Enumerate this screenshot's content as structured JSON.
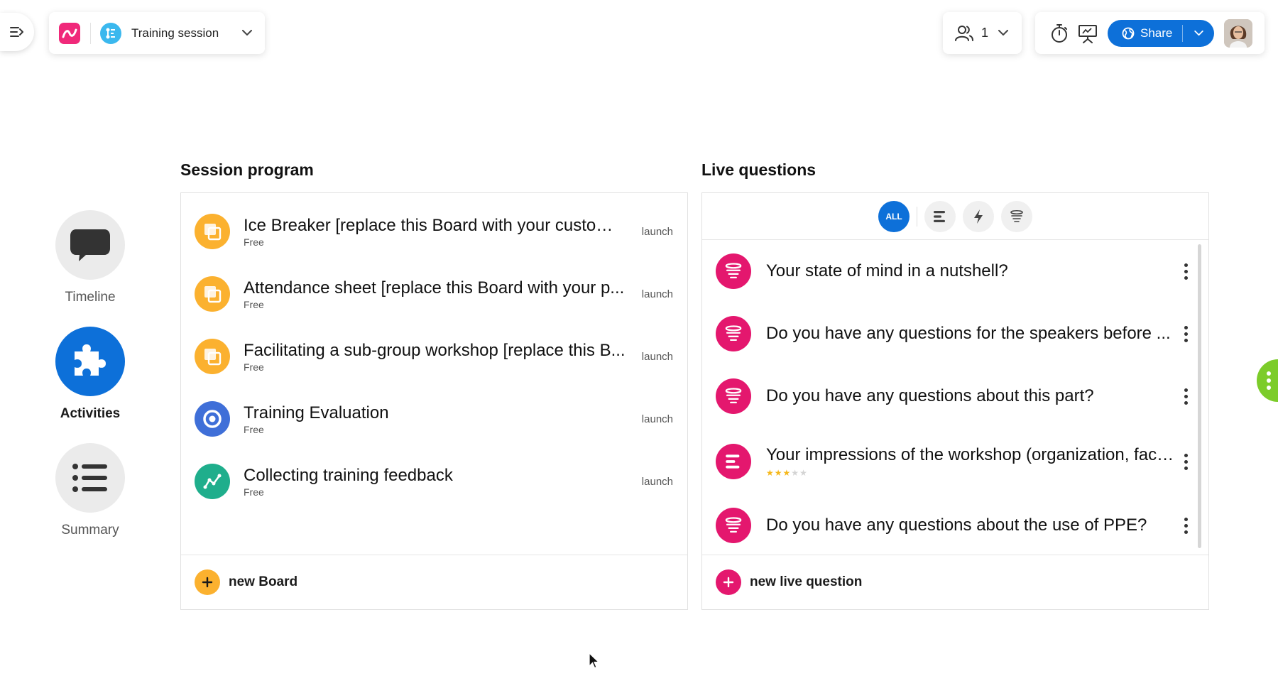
{
  "header": {
    "session_name": "Training session",
    "participants_count": "1",
    "share_label": "Share"
  },
  "nav": {
    "items": [
      {
        "label": "Timeline",
        "icon": "speech-bubble-icon",
        "active": false
      },
      {
        "label": "Activities",
        "icon": "puzzle-icon",
        "active": true
      },
      {
        "label": "Summary",
        "icon": "list-icon",
        "active": false
      }
    ]
  },
  "program": {
    "title": "Session program",
    "rows": [
      {
        "title": "Ice Breaker [replace this Board with your custom ...",
        "subtitle": "Free",
        "action": "launch",
        "icon": "board-icon",
        "color": "#fbb12f"
      },
      {
        "title": "Attendance sheet [replace this Board with your p...",
        "subtitle": "Free",
        "action": "launch",
        "icon": "board-icon",
        "color": "#fbb12f"
      },
      {
        "title": "Facilitating a sub-group workshop [replace this B...",
        "subtitle": "Free",
        "action": "launch",
        "icon": "board-icon",
        "color": "#fbb12f"
      },
      {
        "title": "Training Evaluation",
        "subtitle": "Free",
        "action": "launch",
        "icon": "target-icon",
        "color": "#3f6fd8"
      },
      {
        "title": "Collecting training feedback",
        "subtitle": "Free",
        "action": "launch",
        "icon": "trend-line-icon",
        "color": "#1fae8c"
      }
    ],
    "footer_label": "new Board",
    "footer_color": "#fbb12f"
  },
  "questions": {
    "title": "Live questions",
    "filters": [
      {
        "label": "ALL",
        "icon": "all-icon",
        "active": true
      },
      {
        "label": "",
        "icon": "poll-bars-icon",
        "active": false
      },
      {
        "label": "",
        "icon": "lightning-icon",
        "active": false
      },
      {
        "label": "",
        "icon": "word-cloud-icon",
        "active": false
      }
    ],
    "rows": [
      {
        "title": "Your state of mind in a nutshell?",
        "icon": "word-cloud-icon",
        "rating": 0
      },
      {
        "title": "Do you have any questions for the speakers before ...",
        "icon": "word-cloud-icon",
        "rating": 0
      },
      {
        "title": "Do you have any questions about this part?",
        "icon": "word-cloud-icon",
        "rating": 0
      },
      {
        "title": "Your impressions of the workshop (organization, faci...",
        "icon": "poll-bars-icon",
        "rating": 3,
        "rating_max": 5
      },
      {
        "title": "Do you have any questions about the use of PPE?",
        "icon": "word-cloud-icon",
        "rating": 0
      }
    ],
    "footer_label": "new live question",
    "accent_color": "#e4176e"
  },
  "colors": {
    "primary": "#0d70d9",
    "side_handle": "#7ccc2a"
  }
}
